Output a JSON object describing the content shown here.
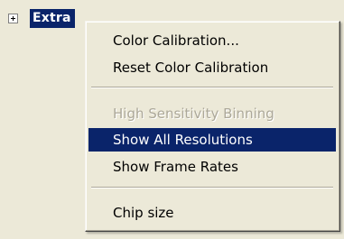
{
  "tree": {
    "expander_icon": "plus-box-icon",
    "node_label": "Extra"
  },
  "menu": {
    "items": [
      {
        "label": "Color Calibration...",
        "state": "enabled"
      },
      {
        "label": "Reset Color Calibration",
        "state": "enabled"
      },
      {
        "label": "High Sensitivity Binning",
        "state": "disabled"
      },
      {
        "label": "Show All Resolutions",
        "state": "selected"
      },
      {
        "label": "Show Frame Rates",
        "state": "enabled"
      },
      {
        "label": "Chip size",
        "state": "enabled"
      }
    ]
  },
  "colors": {
    "background": "#ece9d8",
    "selection": "#0a246a",
    "disabled_text": "#aca899"
  }
}
